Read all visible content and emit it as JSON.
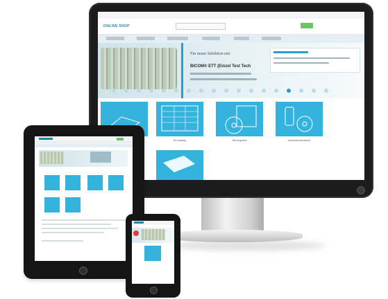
{
  "desktop": {
    "logo": "ONLINE SHOP",
    "banner_title": "Für neues Selektion mit",
    "banner_product": "BICOM® ETT (Einzel Test Tech",
    "tile_captions": [
      "",
      "Ein Katalog",
      "Test Ampullen",
      "Informationsmaterial"
    ]
  },
  "colors": {
    "accent": "#35b3df",
    "bezel": "#1c1c1c",
    "green": "#6dc46a"
  }
}
